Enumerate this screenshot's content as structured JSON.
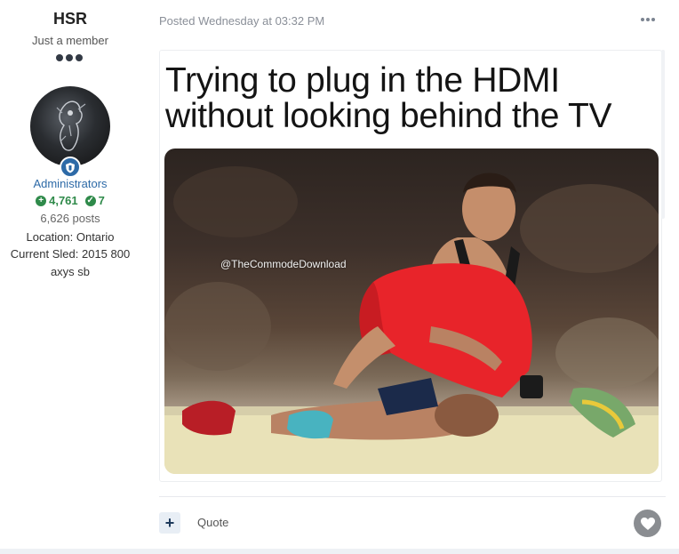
{
  "author": {
    "name": "HSR",
    "title": "Just a member",
    "group": "Administrators",
    "reputation": "4,761",
    "achievements": "7",
    "posts": "6,626 posts",
    "location": "Location: Ontario",
    "sled": "Current Sled: 2015 800 axys sb"
  },
  "post": {
    "date": "Posted Wednesday at 03:32 PM",
    "meme_caption_line1": "Trying to plug in the HDMI",
    "meme_caption_line2": "without looking behind the TV",
    "watermark": "@TheCommodeDownload"
  },
  "footer": {
    "plus_label": "+",
    "quote_label": "Quote"
  },
  "colors": {
    "accent_blue": "#2d6aa7",
    "rep_green": "#2f8a4a",
    "wrestler_red": "#e8242a"
  },
  "icons": {
    "more": "ellipsis-icon",
    "badge": "shield-icon",
    "like": "heart-icon"
  }
}
